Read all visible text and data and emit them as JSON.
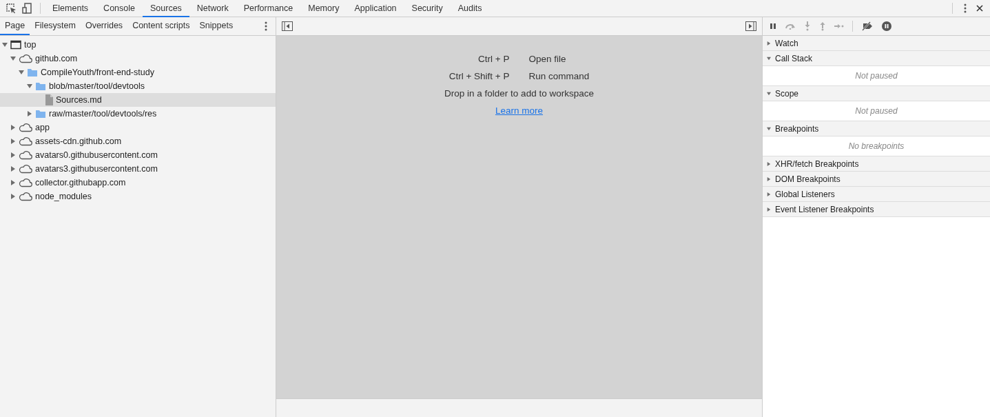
{
  "main_tabs": [
    {
      "label": "Elements",
      "selected": false
    },
    {
      "label": "Console",
      "selected": false
    },
    {
      "label": "Sources",
      "selected": true
    },
    {
      "label": "Network",
      "selected": false
    },
    {
      "label": "Performance",
      "selected": false
    },
    {
      "label": "Memory",
      "selected": false
    },
    {
      "label": "Application",
      "selected": false
    },
    {
      "label": "Security",
      "selected": false
    },
    {
      "label": "Audits",
      "selected": false
    }
  ],
  "navigator": {
    "tabs": [
      {
        "label": "Page",
        "selected": true
      },
      {
        "label": "Filesystem",
        "selected": false
      },
      {
        "label": "Overrides",
        "selected": false
      },
      {
        "label": "Content scripts",
        "selected": false
      },
      {
        "label": "Snippets",
        "selected": false
      }
    ],
    "tree": [
      {
        "label": "top",
        "kind": "frame",
        "expanded": true,
        "selected": false,
        "children": [
          {
            "label": "github.com",
            "kind": "domain",
            "expanded": true,
            "selected": false,
            "children": [
              {
                "label": "CompileYouth/front-end-study",
                "kind": "folder",
                "expanded": true,
                "selected": false,
                "children": [
                  {
                    "label": "blob/master/tool/devtools",
                    "kind": "folder",
                    "expanded": true,
                    "selected": false,
                    "children": [
                      {
                        "label": "Sources.md",
                        "kind": "file",
                        "selected": true
                      }
                    ]
                  },
                  {
                    "label": "raw/master/tool/devtools/res",
                    "kind": "folder",
                    "expanded": false,
                    "selected": false
                  }
                ]
              }
            ]
          },
          {
            "label": "app",
            "kind": "domain",
            "expanded": false,
            "selected": false
          },
          {
            "label": "assets-cdn.github.com",
            "kind": "domain",
            "expanded": false,
            "selected": false
          },
          {
            "label": "avatars0.githubusercontent.com",
            "kind": "domain",
            "expanded": false,
            "selected": false
          },
          {
            "label": "avatars3.githubusercontent.com",
            "kind": "domain",
            "expanded": false,
            "selected": false
          },
          {
            "label": "collector.githubapp.com",
            "kind": "domain",
            "expanded": false,
            "selected": false
          },
          {
            "label": "node_modules",
            "kind": "domain",
            "expanded": false,
            "selected": false
          }
        ]
      }
    ]
  },
  "editor": {
    "shortcuts": [
      {
        "keys": "Ctrl + P",
        "action": "Open file"
      },
      {
        "keys": "Ctrl + Shift + P",
        "action": "Run command"
      }
    ],
    "hint": "Drop in a folder to add to workspace",
    "link": "Learn more"
  },
  "debugger": {
    "sections": [
      {
        "title": "Watch",
        "expanded": false
      },
      {
        "title": "Call Stack",
        "expanded": true,
        "message": "Not paused"
      },
      {
        "title": "Scope",
        "expanded": true,
        "message": "Not paused"
      },
      {
        "title": "Breakpoints",
        "expanded": true,
        "message": "No breakpoints"
      },
      {
        "title": "XHR/fetch Breakpoints",
        "expanded": false
      },
      {
        "title": "DOM Breakpoints",
        "expanded": false
      },
      {
        "title": "Global Listeners",
        "expanded": false
      },
      {
        "title": "Event Listener Breakpoints",
        "expanded": false
      }
    ]
  }
}
